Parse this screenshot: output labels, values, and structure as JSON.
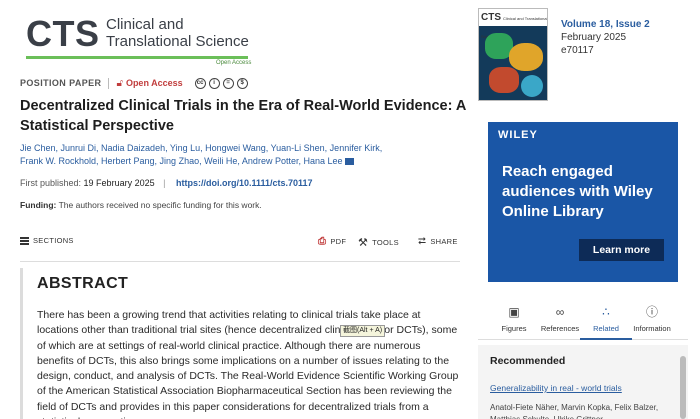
{
  "journal": {
    "logo_text": "CTS",
    "logo_sub_line1": "Clinical and",
    "logo_sub_line2": "Translational Science",
    "logo_open_access": "Open Access"
  },
  "article": {
    "type": "POSITION PAPER",
    "access": "Open Access",
    "title": "Decentralized Clinical Trials in the Era of Real-World Evidence: A Statistical Perspective",
    "authors_line1": "Jie Chen, Junrui Di, Nadia Daizadeh, Ying Lu, Hongwei Wang, Yuan-Li Shen, Jennifer Kirk,",
    "authors_line2": "Frank W. Rockhold, Herbert Pang, Jing Zhao, Weili He, Andrew Potter, Hana Lee",
    "published_label": "First published:",
    "published_date": "19 February 2025",
    "doi": "https://doi.org/10.1111/cts.70117",
    "funding_label": "Funding:",
    "funding_text": "The authors received no specific funding for this work."
  },
  "toolbar": {
    "sections": "SECTIONS",
    "pdf": "PDF",
    "tools": "TOOLS",
    "share": "SHARE"
  },
  "abstract": {
    "heading": "ABSTRACT",
    "text": "There has been a growing trend that activities relating to clinical trials take place at locations other than traditional trial sites (hence decentralized clinical trials or DCTs), some of which are at settings of real-world clinical practice. Although there are numerous benefits of DCTs, this also brings some implications on a number of issues relating to the design, conduct, and analysis of DCTs. The Real-World Evidence Scientific Working Group of the American Statistical Association Biopharmaceutical Section has been reviewing the field of DCTs and provides in this paper considerations for decentralized trials from a statistical perspective."
  },
  "tooltip": {
    "text": "截图(Alt + A)"
  },
  "cover": {
    "title": "CTS",
    "subtitle": "Clinical and Translational Science"
  },
  "issue": {
    "volume": "Volume 18, Issue 2",
    "date": "February 2025",
    "number": "e70117"
  },
  "ad": {
    "brand": "WILEY",
    "headline": "Reach engaged audiences with Wiley Online Library",
    "button": "Learn more"
  },
  "right_tabs": [
    {
      "label": "Figures",
      "icon": "image-icon"
    },
    {
      "label": "References",
      "icon": "link-icon"
    },
    {
      "label": "Related",
      "icon": "network-icon"
    },
    {
      "label": "Information",
      "icon": "info-icon"
    }
  ],
  "recommended": {
    "heading": "Recommended",
    "item_title": "Generalizability in real - world trials",
    "item_authors": "Anatol-Fiete Näher, Marvin Kopka, Felix Balzer, Matthias Schulte, Ulrike Grittner"
  },
  "colors": {
    "link": "#2a5d9f",
    "accent_red": "#c13d3d",
    "ad_bg": "#1a56a6",
    "logo_green": "#6bbf59"
  }
}
